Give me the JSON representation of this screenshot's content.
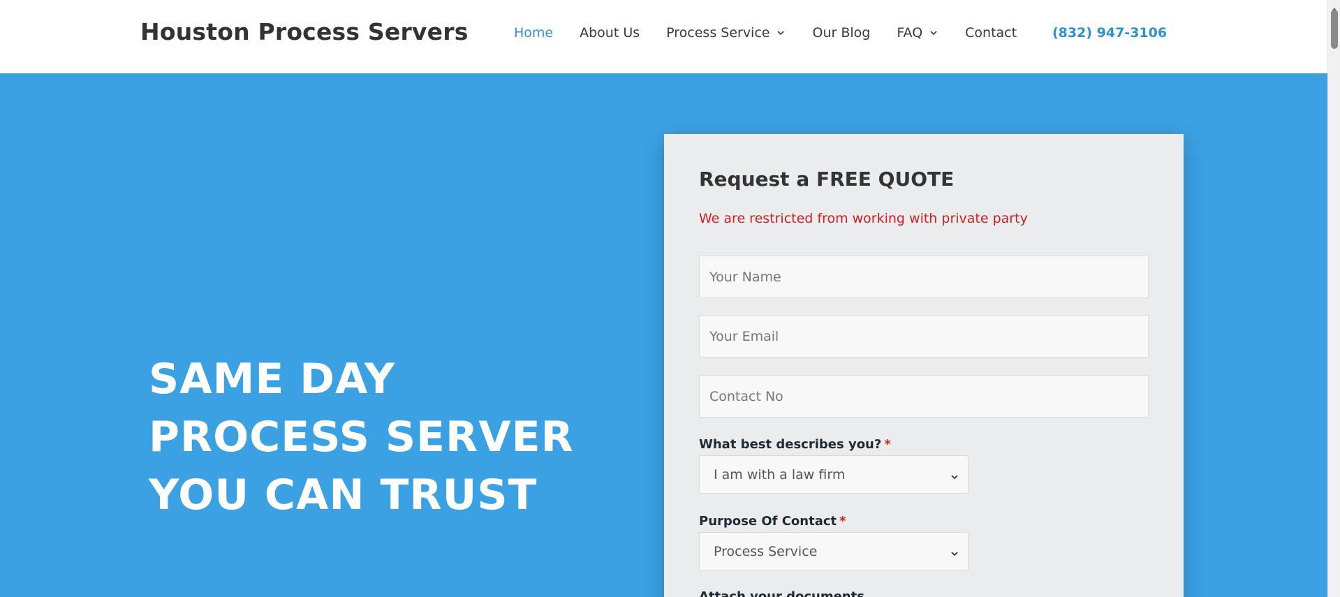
{
  "header": {
    "brand": "Houston Process Servers",
    "nav": {
      "home": "Home",
      "about": "About Us",
      "process_service": "Process Service",
      "blog": "Our Blog",
      "faq": "FAQ",
      "contact": "Contact"
    },
    "phone": "(832) 947-3106"
  },
  "hero": {
    "title_lines": [
      "SAME DAY",
      "PROCESS SERVER",
      "YOU CAN TRUST"
    ]
  },
  "quote_form": {
    "title": "Request a FREE QUOTE",
    "notice": "We are restricted from working with private party",
    "name_placeholder": "Your Name",
    "email_placeholder": "Your Email",
    "phone_placeholder": "Contact No",
    "describe_label": "What best describes you?",
    "describe_value": "I am with a law firm",
    "purpose_label": "Purpose Of Contact",
    "purpose_value": "Process Service",
    "attach_label": "Attach your documents",
    "required_mark": "*"
  },
  "colors": {
    "hero_bg": "#3ba1e3",
    "accent": "#2e8fd6",
    "notice": "#d11f1f",
    "card_bg": "#ebecee"
  },
  "icons": {
    "nav_dropdown": "chevron-down-icon",
    "select_dropdown": "chevron-down-icon",
    "scroll_up": "scroll-up-arrow-icon"
  }
}
